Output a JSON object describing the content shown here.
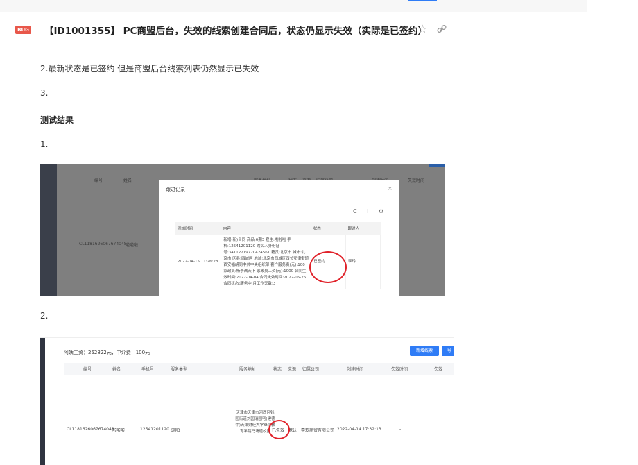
{
  "header": {
    "badge": "BUG",
    "title": "【ID1001355】 PC商盟后台，失效的线索创建合同后，状态仍显示失效（实际是已签约）"
  },
  "content": {
    "line_2": "2.最新状态是已签约    但是商盟后台线索列表仍然显示已失效",
    "line_3": "3.",
    "section_heading": "测试结果",
    "item_1": "1.",
    "item_2": "2."
  },
  "screenshot1": {
    "bg_header": [
      "编号",
      "姓名",
      "服务地址",
      "状态",
      "来源",
      "归属公司",
      "创建时间",
      "失效时间"
    ],
    "bg_row_id": "CL1181626067674048",
    "bg_row_name": "啦啦啦",
    "dialog_title": "跟进记录",
    "dialog_close": "×",
    "dialog_tools": "C I ⚙",
    "columns": [
      "添加时间",
      "内容",
      "状态",
      "跟进人"
    ],
    "row": {
      "time": "2022-04-15 11:26:28",
      "content": "新增(新)合同 商品:6期3 雇主:啦啦啦 手机:12541201120 购买人身份证号:34112219720424561 籍贯:北京市 城市:北京市 区县:西城区 地址:北京市西城区西长安街街道西安福胡同中共中央组织部 套户服务费(元):100 家政员:杨李满天下 家政员工资(元):1000 合同生效时间:2022-04-04 合同失效时间:2022-05-26 合同状态:服务中 月工作天数:3",
      "status": "已签约",
      "owner": "李玲"
    }
  },
  "screenshot2": {
    "summary": "阿姨工资：252822元，中介费：100元",
    "btn_new": "新增线索",
    "btn_more": "导",
    "columns": [
      "编号",
      "姓名",
      "手机号",
      "服务类型",
      "服务地址",
      "状态",
      "来源",
      "归属公司",
      "创建时间",
      "失效时间",
      "失效"
    ],
    "row": {
      "id": "CL1181626067674048",
      "name": "啦啦啦",
      "phone": "12541201120",
      "service": "6期3",
      "address": "天津市天津市河西区钱园街道刘园瑞园宅(建德中)天津财经大学继续教育学院马场道校区",
      "status": "已失效",
      "source": "默认",
      "company": "李玲商贸有限公司",
      "created": "2022-04-14 17:32:13",
      "expired": "-"
    }
  },
  "colors": {
    "bug_badge": "#e8574a",
    "annotation_circle": "#e0222a",
    "primary_button": "#2f7cf6"
  }
}
